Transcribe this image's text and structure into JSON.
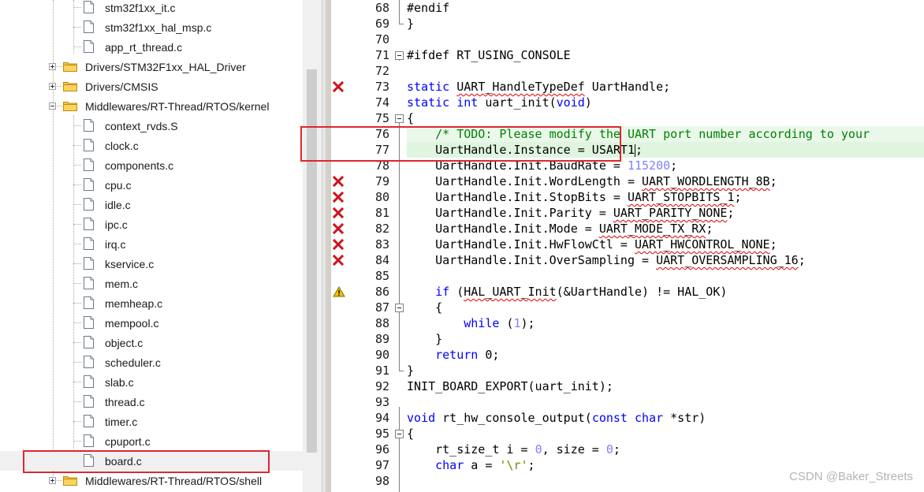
{
  "tree": {
    "items": [
      {
        "label": "stm32f1xx_it.c",
        "type": "file"
      },
      {
        "label": "stm32f1xx_hal_msp.c",
        "type": "file"
      },
      {
        "label": "app_rt_thread.c",
        "type": "file"
      },
      {
        "label": "Drivers/STM32F1xx_HAL_Driver",
        "type": "folder",
        "state": "collapsed"
      },
      {
        "label": "Drivers/CMSIS",
        "type": "folder",
        "state": "collapsed"
      },
      {
        "label": "Middlewares/RT-Thread/RTOS/kernel",
        "type": "folder",
        "state": "expanded"
      },
      {
        "label": "context_rvds.S",
        "type": "file"
      },
      {
        "label": "clock.c",
        "type": "file"
      },
      {
        "label": "components.c",
        "type": "file"
      },
      {
        "label": "cpu.c",
        "type": "file"
      },
      {
        "label": "idle.c",
        "type": "file"
      },
      {
        "label": "ipc.c",
        "type": "file"
      },
      {
        "label": "irq.c",
        "type": "file"
      },
      {
        "label": "kservice.c",
        "type": "file"
      },
      {
        "label": "mem.c",
        "type": "file"
      },
      {
        "label": "memheap.c",
        "type": "file"
      },
      {
        "label": "mempool.c",
        "type": "file"
      },
      {
        "label": "object.c",
        "type": "file"
      },
      {
        "label": "scheduler.c",
        "type": "file"
      },
      {
        "label": "slab.c",
        "type": "file"
      },
      {
        "label": "thread.c",
        "type": "file"
      },
      {
        "label": "timer.c",
        "type": "file"
      },
      {
        "label": "cpuport.c",
        "type": "file"
      },
      {
        "label": "board.c",
        "type": "file",
        "selected": true
      },
      {
        "label": "Middlewares/RT-Thread/RTOS/shell",
        "type": "folder",
        "state": "collapsed"
      }
    ]
  },
  "editor": {
    "lines": [
      {
        "n": "68",
        "text": "#endif"
      },
      {
        "n": "69",
        "text": "}"
      },
      {
        "n": "70",
        "text": ""
      },
      {
        "n": "71",
        "text": "#ifdef RT_USING_CONSOLE"
      },
      {
        "n": "72",
        "text": ""
      },
      {
        "n": "73",
        "text": "static UART_HandleTypeDef UartHandle;",
        "marker": "error"
      },
      {
        "n": "74",
        "text": "static int uart_init(void)"
      },
      {
        "n": "75",
        "text": "{"
      },
      {
        "n": "76",
        "text": "    /* TODO: Please modify the UART port number according to your"
      },
      {
        "n": "77",
        "text": "    UartHandle.Instance = USART1;"
      },
      {
        "n": "78",
        "text": "    UartHandle.Init.BaudRate = 115200;"
      },
      {
        "n": "79",
        "text": "    UartHandle.Init.WordLength = UART_WORDLENGTH_8B;",
        "marker": "error"
      },
      {
        "n": "80",
        "text": "    UartHandle.Init.StopBits = UART_STOPBITS_1;",
        "marker": "error"
      },
      {
        "n": "81",
        "text": "    UartHandle.Init.Parity = UART_PARITY_NONE;",
        "marker": "error"
      },
      {
        "n": "82",
        "text": "    UartHandle.Init.Mode = UART_MODE_TX_RX;",
        "marker": "error"
      },
      {
        "n": "83",
        "text": "    UartHandle.Init.HwFlowCtl = UART_HWCONTROL_NONE;",
        "marker": "error"
      },
      {
        "n": "84",
        "text": "    UartHandle.Init.OverSampling = UART_OVERSAMPLING_16;",
        "marker": "error"
      },
      {
        "n": "85",
        "text": ""
      },
      {
        "n": "86",
        "text": "    if (HAL_UART_Init(&UartHandle) != HAL_OK)",
        "marker": "warning"
      },
      {
        "n": "87",
        "text": "    {"
      },
      {
        "n": "88",
        "text": "        while (1);"
      },
      {
        "n": "89",
        "text": "    }"
      },
      {
        "n": "90",
        "text": "    return 0;"
      },
      {
        "n": "91",
        "text": "}"
      },
      {
        "n": "92",
        "text": "INIT_BOARD_EXPORT(uart_init);"
      },
      {
        "n": "93",
        "text": ""
      },
      {
        "n": "94",
        "text": "void rt_hw_console_output(const char *str)"
      },
      {
        "n": "95",
        "text": "{"
      },
      {
        "n": "96",
        "text": "    rt_size_t i = 0, size = 0;"
      },
      {
        "n": "97",
        "text": "    char a = '\\r';"
      },
      {
        "n": "98",
        "text": ""
      }
    ]
  },
  "watermark": "CSDN @Baker_Streets",
  "colors": {
    "keyword": "#0000ff",
    "comment": "#008000",
    "number": "#8080ff",
    "string": "#808000",
    "error_marker": "#d0121b",
    "warning_marker": "#f2c200",
    "annotation_box": "#e0262f",
    "current_line": "#e6f7e6"
  }
}
